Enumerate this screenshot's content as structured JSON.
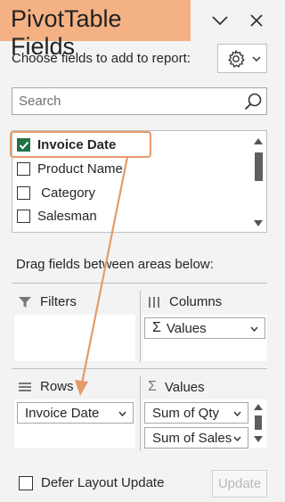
{
  "header": {
    "title": "PivotTable Fields"
  },
  "choose_label": "Choose fields to add to report:",
  "search": {
    "placeholder": "Search",
    "value": ""
  },
  "fields": [
    {
      "label": "Invoice Date",
      "checked": true
    },
    {
      "label": "Product Name",
      "checked": false
    },
    {
      "label": " Category",
      "checked": false
    },
    {
      "label": "Salesman",
      "checked": false
    }
  ],
  "drag_label": "Drag fields between areas below:",
  "areas": {
    "filters": {
      "label": "Filters"
    },
    "columns": {
      "label": "Columns",
      "items": [
        "Values"
      ]
    },
    "rows": {
      "label": "Rows",
      "items": [
        "Invoice Date"
      ]
    },
    "values": {
      "label": "Values",
      "items": [
        "Sum of Qty",
        "Sum of Sales"
      ]
    }
  },
  "footer": {
    "defer_label": "Defer Layout Update",
    "update_label": "Update"
  },
  "colors": {
    "title_bg": "#f4b183",
    "check_green": "#217346",
    "highlight": "#e59a6a"
  },
  "icons": [
    "chevron-down-icon",
    "close-icon",
    "gear-icon",
    "search-icon",
    "filter-icon",
    "columns-icon",
    "rows-icon",
    "sigma-icon"
  ]
}
